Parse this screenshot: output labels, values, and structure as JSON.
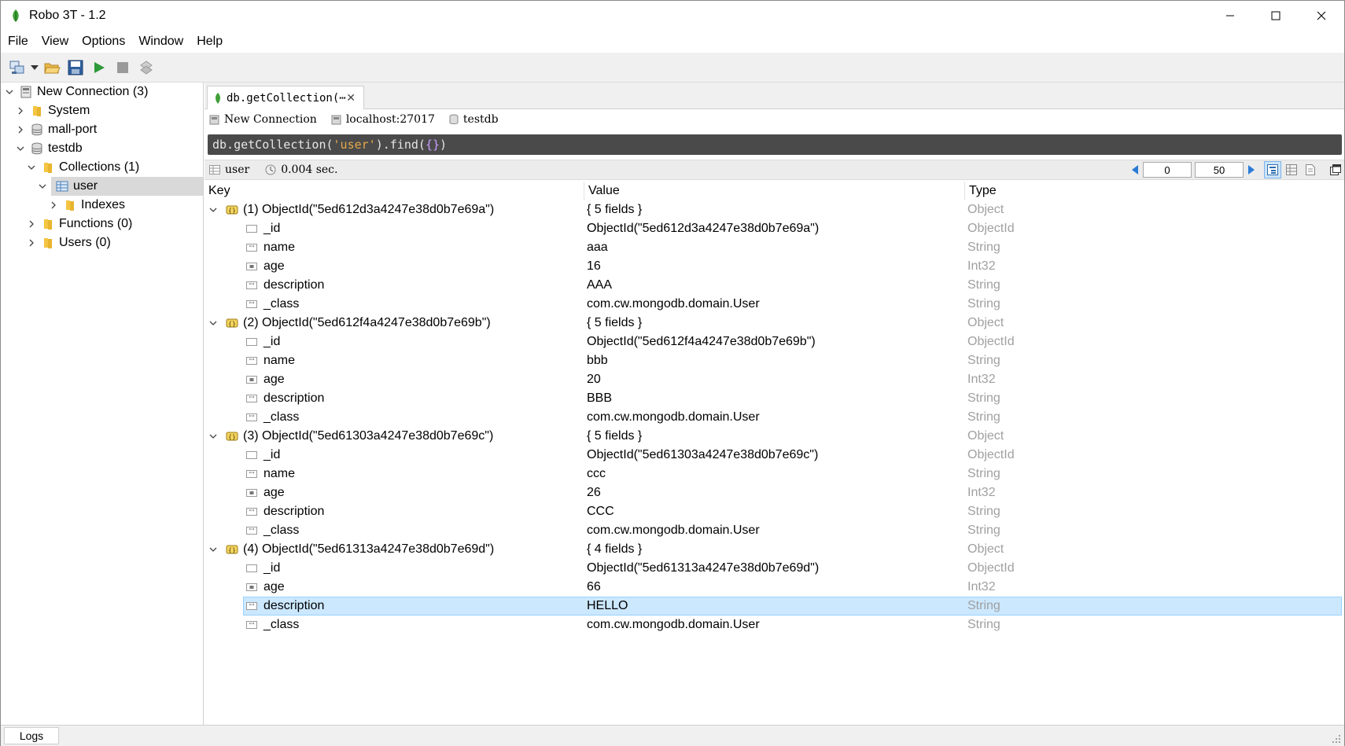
{
  "window": {
    "title": "Robo 3T - 1.2"
  },
  "menu": [
    "File",
    "View",
    "Options",
    "Window",
    "Help"
  ],
  "sidebar": {
    "items": [
      {
        "label": "New Connection (3)",
        "icon": "server-icon",
        "expanded": true
      },
      {
        "label": "System",
        "icon": "folder-icon",
        "expanded": false
      },
      {
        "label": "mall-port",
        "icon": "database-icon",
        "expanded": false
      },
      {
        "label": "testdb",
        "icon": "database-icon",
        "expanded": true
      },
      {
        "label": "Collections (1)",
        "icon": "folder-icon",
        "expanded": true
      },
      {
        "label": "user",
        "icon": "collection-icon",
        "expanded": true,
        "selected": true
      },
      {
        "label": "Indexes",
        "icon": "folder-icon",
        "expanded": false
      },
      {
        "label": "Functions (0)",
        "icon": "folder-icon",
        "expanded": false
      },
      {
        "label": "Users (0)",
        "icon": "folder-icon",
        "expanded": false
      }
    ]
  },
  "tab": {
    "label": "db.getCollection(⋯",
    "close": "✕"
  },
  "info": {
    "connection": "New Connection",
    "host": "localhost:27017",
    "database": "testdb"
  },
  "query": {
    "prefix": "db.getCollection(",
    "arg": "'user'",
    "middle": ").find(",
    "braces": "{}",
    "suffix": ")"
  },
  "result": {
    "collection": "user",
    "time": "0.004 sec.",
    "skip": "0",
    "limit": "50"
  },
  "grid": {
    "headers": {
      "key": "Key",
      "value": "Value",
      "type": "Type"
    },
    "rows": [
      {
        "kind": "doc",
        "key": "(1) ObjectId(\"5ed612d3a4247e38d0b7e69a\")",
        "value": "{ 5 fields }",
        "type": "Object"
      },
      {
        "kind": "field",
        "icon": "objectid-icon",
        "key": "_id",
        "value": "ObjectId(\"5ed612d3a4247e38d0b7e69a\")",
        "type": "ObjectId"
      },
      {
        "kind": "field",
        "icon": "string-icon",
        "key": "name",
        "value": "aaa",
        "type": "String"
      },
      {
        "kind": "field",
        "icon": "int-icon",
        "key": "age",
        "value": "16",
        "type": "Int32"
      },
      {
        "kind": "field",
        "icon": "string-icon",
        "key": "description",
        "value": "AAA",
        "type": "String"
      },
      {
        "kind": "field",
        "icon": "string-icon",
        "key": "_class",
        "value": "com.cw.mongodb.domain.User",
        "type": "String"
      },
      {
        "kind": "doc",
        "key": "(2) ObjectId(\"5ed612f4a4247e38d0b7e69b\")",
        "value": "{ 5 fields }",
        "type": "Object"
      },
      {
        "kind": "field",
        "icon": "objectid-icon",
        "key": "_id",
        "value": "ObjectId(\"5ed612f4a4247e38d0b7e69b\")",
        "type": "ObjectId"
      },
      {
        "kind": "field",
        "icon": "string-icon",
        "key": "name",
        "value": "bbb",
        "type": "String"
      },
      {
        "kind": "field",
        "icon": "int-icon",
        "key": "age",
        "value": "20",
        "type": "Int32"
      },
      {
        "kind": "field",
        "icon": "string-icon",
        "key": "description",
        "value": "BBB",
        "type": "String"
      },
      {
        "kind": "field",
        "icon": "string-icon",
        "key": "_class",
        "value": "com.cw.mongodb.domain.User",
        "type": "String"
      },
      {
        "kind": "doc",
        "key": "(3) ObjectId(\"5ed61303a4247e38d0b7e69c\")",
        "value": "{ 5 fields }",
        "type": "Object"
      },
      {
        "kind": "field",
        "icon": "objectid-icon",
        "key": "_id",
        "value": "ObjectId(\"5ed61303a4247e38d0b7e69c\")",
        "type": "ObjectId"
      },
      {
        "kind": "field",
        "icon": "string-icon",
        "key": "name",
        "value": "ccc",
        "type": "String"
      },
      {
        "kind": "field",
        "icon": "int-icon",
        "key": "age",
        "value": "26",
        "type": "Int32"
      },
      {
        "kind": "field",
        "icon": "string-icon",
        "key": "description",
        "value": "CCC",
        "type": "String"
      },
      {
        "kind": "field",
        "icon": "string-icon",
        "key": "_class",
        "value": "com.cw.mongodb.domain.User",
        "type": "String"
      },
      {
        "kind": "doc",
        "key": "(4) ObjectId(\"5ed61313a4247e38d0b7e69d\")",
        "value": "{ 4 fields }",
        "type": "Object"
      },
      {
        "kind": "field",
        "icon": "objectid-icon",
        "key": "_id",
        "value": "ObjectId(\"5ed61313a4247e38d0b7e69d\")",
        "type": "ObjectId"
      },
      {
        "kind": "field",
        "icon": "int-icon",
        "key": "age",
        "value": "66",
        "type": "Int32"
      },
      {
        "kind": "field",
        "icon": "string-icon",
        "key": "description",
        "value": "HELLO",
        "type": "String",
        "selected": true
      },
      {
        "kind": "field",
        "icon": "string-icon",
        "key": "_class",
        "value": "com.cw.mongodb.domain.User",
        "type": "String"
      }
    ]
  },
  "logs": {
    "label": "Logs"
  },
  "colors": {
    "selection": "#cce8ff",
    "type_text": "#a0a0a0",
    "query_bg": "#4a4a4a",
    "query_string": "#e6a94d",
    "brand": "#3fa037"
  }
}
